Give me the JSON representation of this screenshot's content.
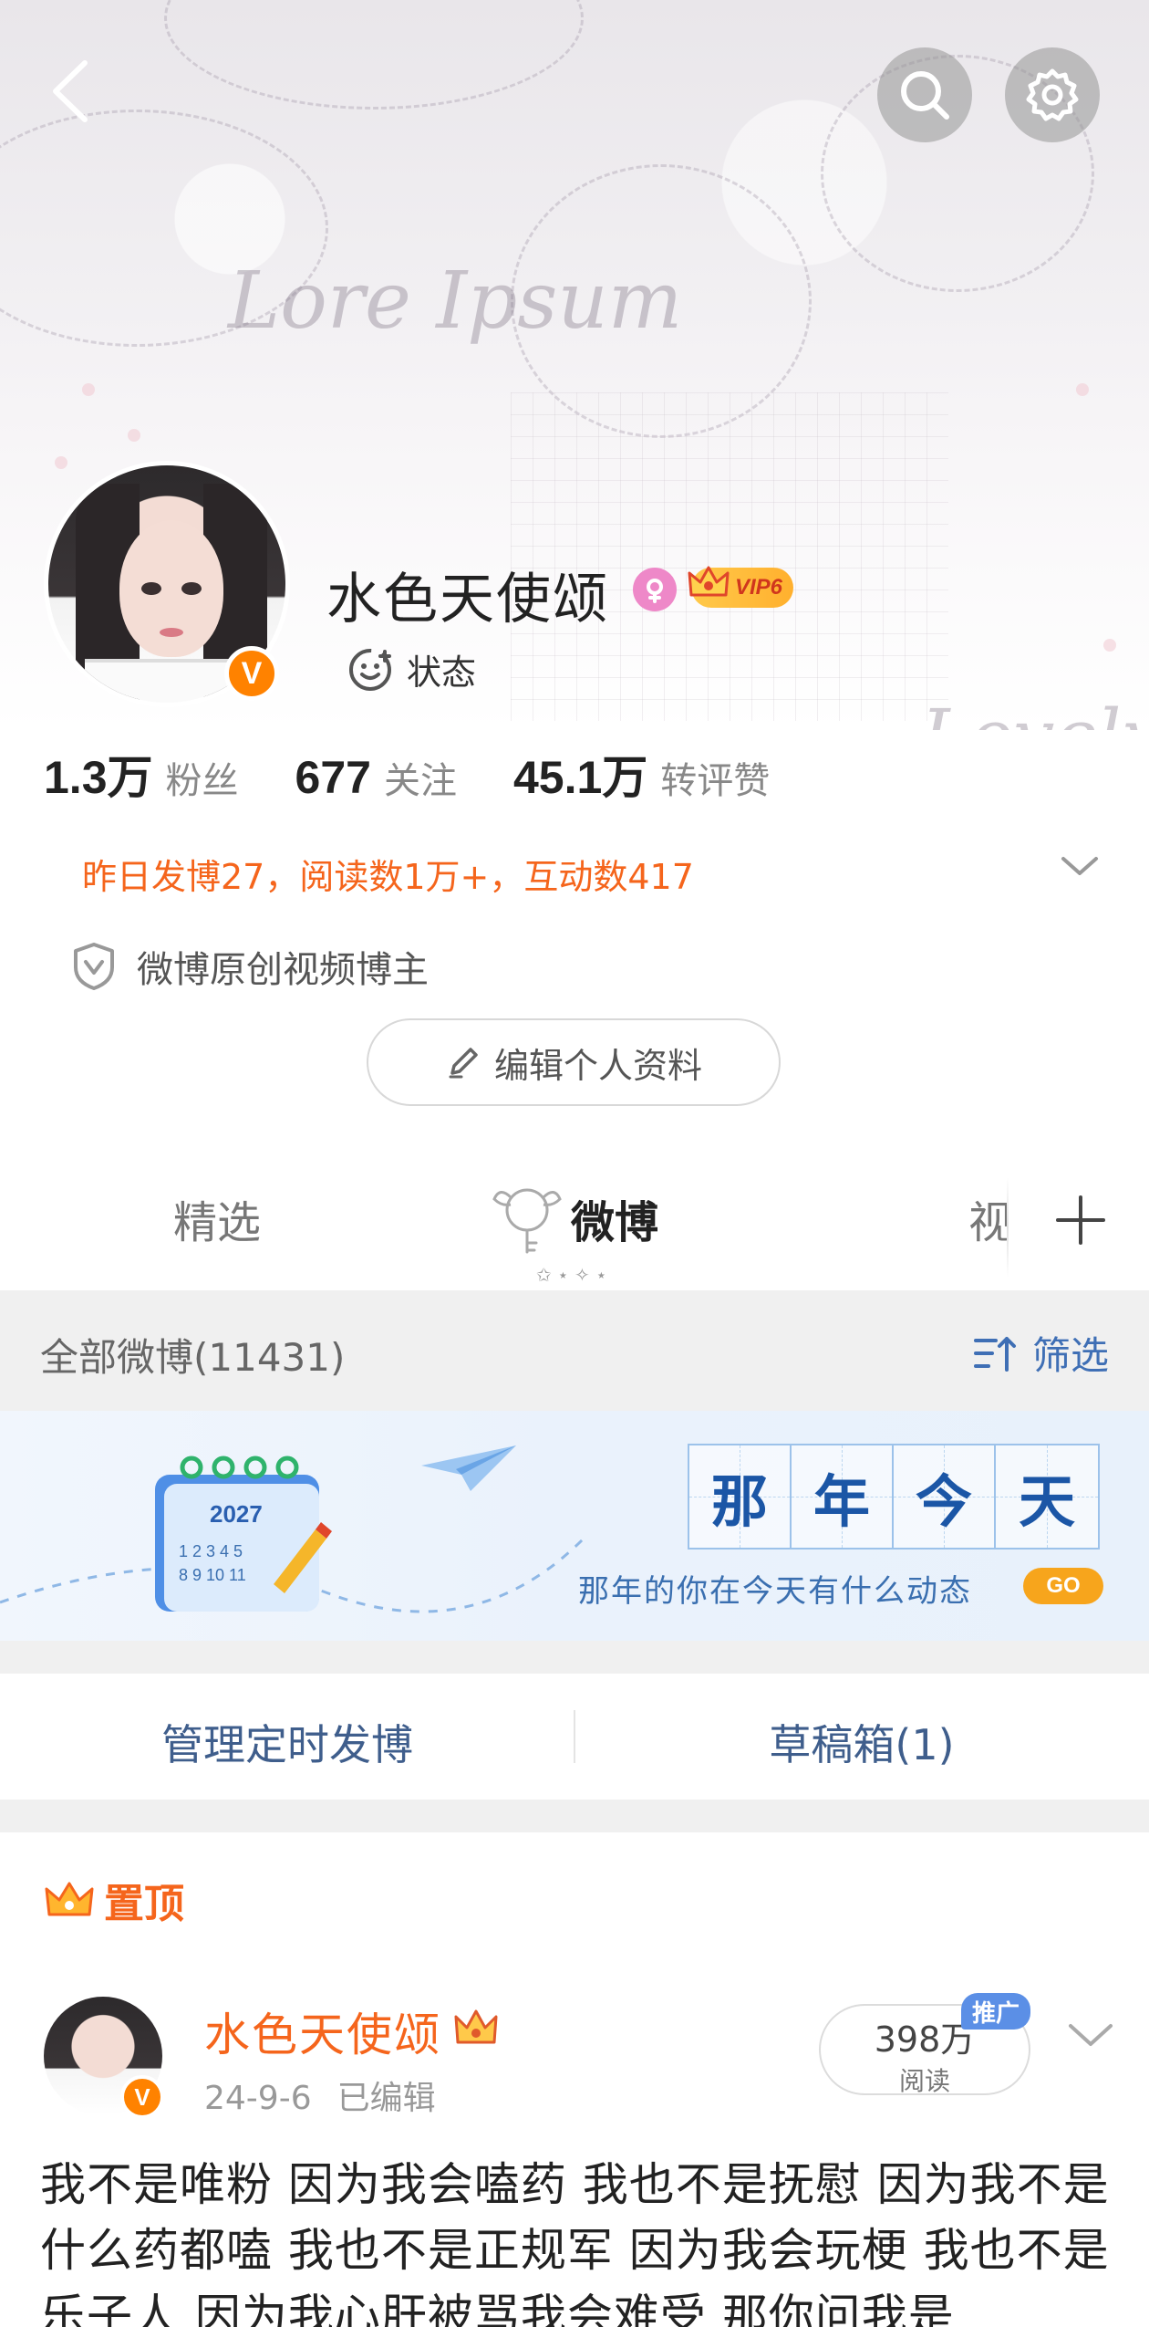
{
  "profile": {
    "name": "水色天使颂",
    "vip_label": "VIP6",
    "verified_mark": "V",
    "status_label": "状态"
  },
  "stats": [
    {
      "value": "1.3万",
      "label": "粉丝"
    },
    {
      "value": "677",
      "label": "关注"
    },
    {
      "value": "45.1万",
      "label": "转评赞"
    }
  ],
  "summary_text": "昨日发博27，阅读数1万+，互动数417",
  "certification": "微博原创视频博主",
  "edit_profile_label": "编辑个人资料",
  "tabs": [
    {
      "label": "精选",
      "active": false
    },
    {
      "label": "微博",
      "active": true
    },
    {
      "label": "视",
      "active": false
    }
  ],
  "filter_bar": {
    "all_posts": "全部微博(11431)",
    "filter_label": "筛选"
  },
  "memory_banner": {
    "year": "2027",
    "chars": [
      "那",
      "年",
      "今",
      "天"
    ],
    "subtitle": "那年的你在今天有什么动态",
    "go_label": "GO"
  },
  "actions": {
    "scheduled": "管理定时发博",
    "drafts": "草稿箱(1)"
  },
  "pinned_post": {
    "pin_label": "置顶",
    "author": "水色天使颂",
    "verified_mark": "V",
    "date": "24-9-6",
    "edited": "已编辑",
    "reads_value": "398万",
    "reads_label": "阅读",
    "promo_label": "推广",
    "text": "我不是唯粉 因为我会嗑药 我也不是抚慰 因为我不是什么药都嗑 我也不是正规军 因为我会玩梗 我也不是乐子人 因为我心肝被骂我会难受 那你问我是"
  },
  "colors": {
    "accent_orange": "#f5651c",
    "link_blue": "#3f6fb5",
    "vip_gold": "#ffc94a"
  },
  "icons": {
    "back": "chevron-left-icon",
    "search": "search-icon",
    "settings": "gear-icon",
    "status": "smiley-dotted-icon",
    "cert": "shield-v-icon",
    "edit": "pencil-icon",
    "filter": "filter-sort-icon",
    "plus": "plus-icon",
    "chevron": "chevron-down-icon",
    "crown": "crown-icon"
  }
}
